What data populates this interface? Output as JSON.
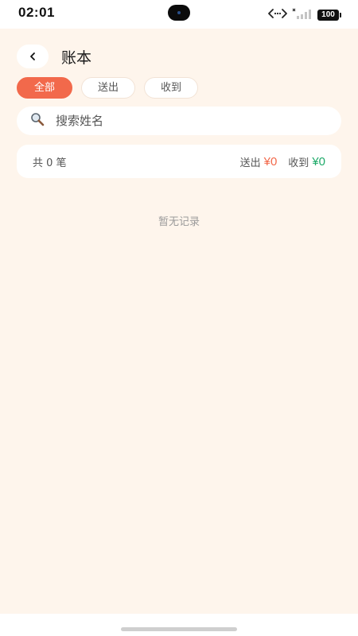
{
  "status_bar": {
    "time": "02:01",
    "battery": "100",
    "icons": [
      "data-transfer-icon",
      "signal-icon",
      "battery-icon"
    ]
  },
  "header": {
    "back_icon": "chevron-left-icon",
    "title": "账本"
  },
  "filter_tabs": [
    {
      "label": "全部",
      "active": true
    },
    {
      "label": "送出",
      "active": false
    },
    {
      "label": "收到",
      "active": false
    }
  ],
  "search": {
    "icon": "search-icon",
    "placeholder": "搜索姓名",
    "value": ""
  },
  "summary": {
    "count_text": "共 0 笔",
    "sent_label": "送出",
    "sent_amount": "¥0",
    "received_label": "收到",
    "received_amount": "¥0"
  },
  "empty_state": {
    "text": "暂无记录"
  },
  "colors": {
    "accent": "#f2694b",
    "received": "#1faa6a",
    "page_background": "#fef5ec"
  }
}
